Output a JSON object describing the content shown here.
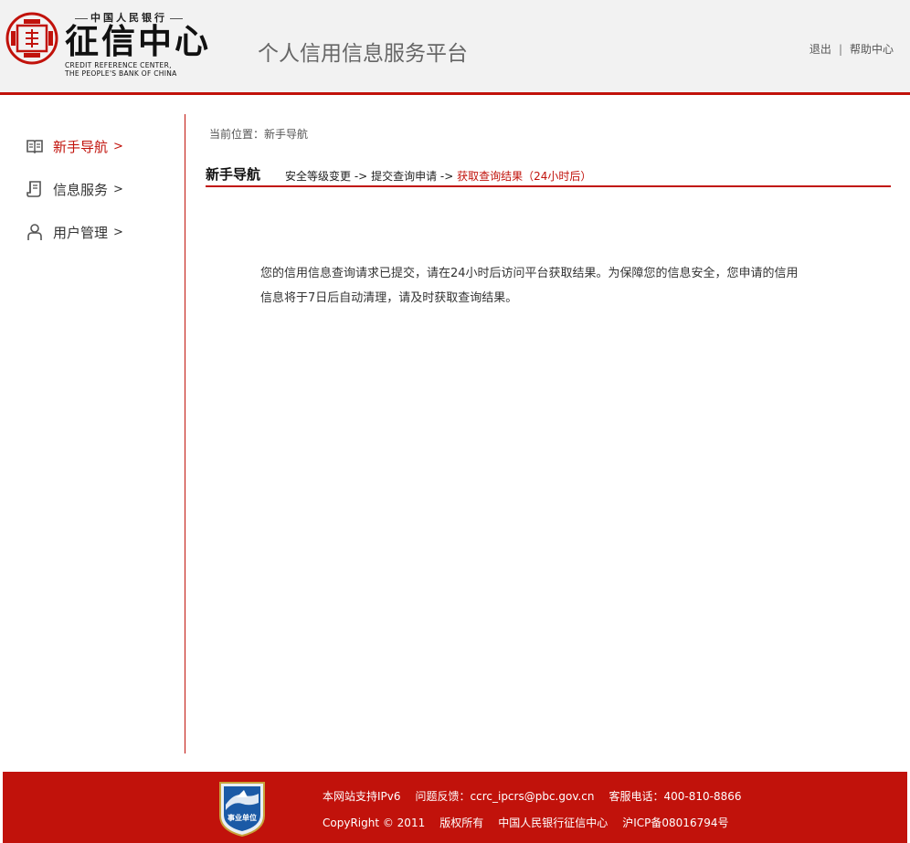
{
  "header": {
    "logo_pboc": "中国人民银行",
    "logo_cn": "征信中心",
    "logo_en_line1": "CREDIT REFERENCE CENTER,",
    "logo_en_line2": "THE PEOPLE'S BANK OF CHINA",
    "platform_title": "个人信用信息服务平台",
    "logout": "退出",
    "separator": "|",
    "help": "帮助中心",
    "accent_color": "#c1120b"
  },
  "sidebar": {
    "items": [
      {
        "label": "新手导航",
        "arrow": ">",
        "icon": "book-icon",
        "active": true
      },
      {
        "label": "信息服务",
        "arrow": ">",
        "icon": "document-icon",
        "active": false
      },
      {
        "label": "用户管理",
        "arrow": ">",
        "icon": "user-icon",
        "active": false
      }
    ]
  },
  "main": {
    "breadcrumb": "当前位置：新手导航",
    "section_title": "新手导航",
    "steps": [
      {
        "label": "安全等级变更",
        "sep": "->"
      },
      {
        "label": "提交查询申请",
        "sep": "->"
      },
      {
        "label": "获取查询结果（24小时后）",
        "sep": ""
      }
    ],
    "notice_line1": "您的信用信息查询请求已提交，请在24小时后访问平台获取结果。为保障您的信息安全，您申请的信用",
    "notice_line2": "信息将于7日后自动清理，请及时获取查询结果。"
  },
  "footer": {
    "badge_text": "事业单位",
    "ipv6": "本网站支持IPv6",
    "feedback": "问题反馈：ccrc_ipcrs@pbc.gov.cn",
    "phone": "客服电话：400-810-8866",
    "copyright": "CopyRight © 2011",
    "rights": "版权所有",
    "org": "中国人民银行征信中心",
    "icp": "沪ICP备08016794号"
  }
}
